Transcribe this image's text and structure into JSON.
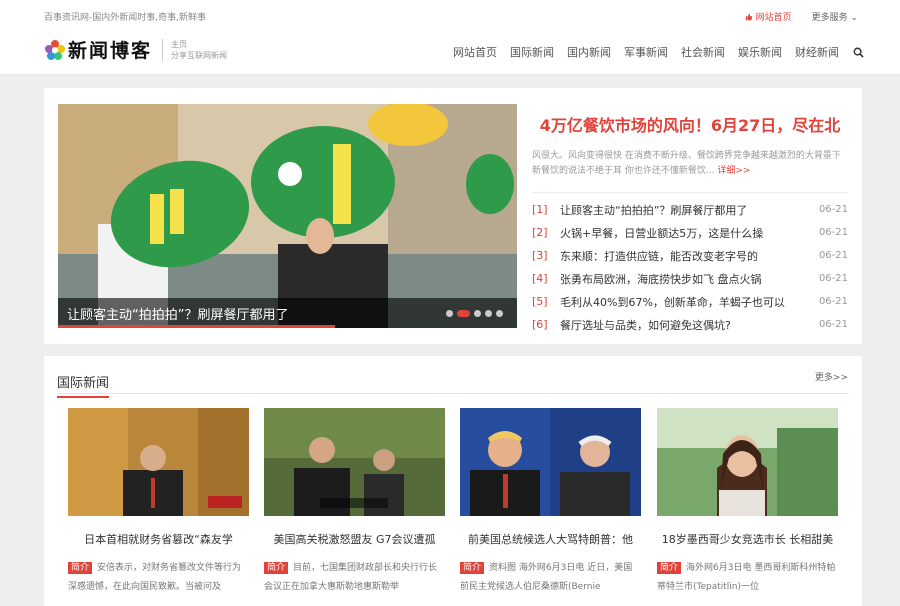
{
  "topbar": {
    "slogan": "百事资讯网-国内外新闻时事,奇事,新鲜事",
    "home_label": "网站首页",
    "more_label": "更多服务 ⌄"
  },
  "header": {
    "logo_text": "新闻博客",
    "logo_sub1": "主页",
    "logo_sub2": "分享互联网新闻",
    "nav": [
      "网站首页",
      "国际新闻",
      "国内新闻",
      "军事新闻",
      "社会新闻",
      "娱乐新闻",
      "财经新闻"
    ]
  },
  "featured": {
    "caption": "让顾客主动“拍拍拍”？刷屏餐厅都用了",
    "slider_active": 2,
    "slider_count": 5,
    "headline": "4万亿餐饮市场的风向！6月27日，尽在北",
    "summary": "风很大。风向变得很快 在消费不断升级、餐饮跨界竞争越来越激烈的大背景下 新餐饮的说法不绝于耳 你也许还不懂新餐饮...",
    "detail_label": "详细>>",
    "list": [
      {
        "num": "[1]",
        "title": "让顾客主动“拍拍拍”？刷屏餐厅都用了",
        "date": "06-21"
      },
      {
        "num": "[2]",
        "title": "火锅+早餐，日营业额达5万，这是什么操",
        "date": "06-21"
      },
      {
        "num": "[3]",
        "title": "东来顺：打造供应链，能否改变老字号的",
        "date": "06-21"
      },
      {
        "num": "[4]",
        "title": "张勇布局欧洲，海底捞快步如飞 盘点火锅",
        "date": "06-21"
      },
      {
        "num": "[5]",
        "title": "毛利从40%到67%，创新革命，羊蝎子也可以",
        "date": "06-21"
      },
      {
        "num": "[6]",
        "title": "餐厅选址与品类，如何避免这偶坑?",
        "date": "06-21"
      }
    ]
  },
  "intl": {
    "title": "国际新闻",
    "more": "更多>>",
    "tag": "简介",
    "cards": [
      {
        "title": "日本首相就财务省篡改“森友学",
        "desc": "安倍表示，对财务省篡改文件等行为深感遗憾，在此向国民致歉。当被问及"
      },
      {
        "title": "美国高关税激怒盟友 G7会议遭孤",
        "desc": "目前，七国集团财政部长和央行行长会议正在加拿大惠斯勒地惠斯勒举"
      },
      {
        "title": "前美国总统候选人大骂特朗普：他",
        "desc": "资料图 海外网6月3日电 近日，美国前民主党候选人伯尼桑德斯(Bernie"
      },
      {
        "title": "18岁墨西哥少女竞选市长 长相甜美",
        "desc": "海外网6月3日电 墨西哥利斯科州特帕蒂特兰市(Tepatitlin)一位"
      }
    ]
  },
  "colors": {
    "accent": "#e0433a"
  }
}
